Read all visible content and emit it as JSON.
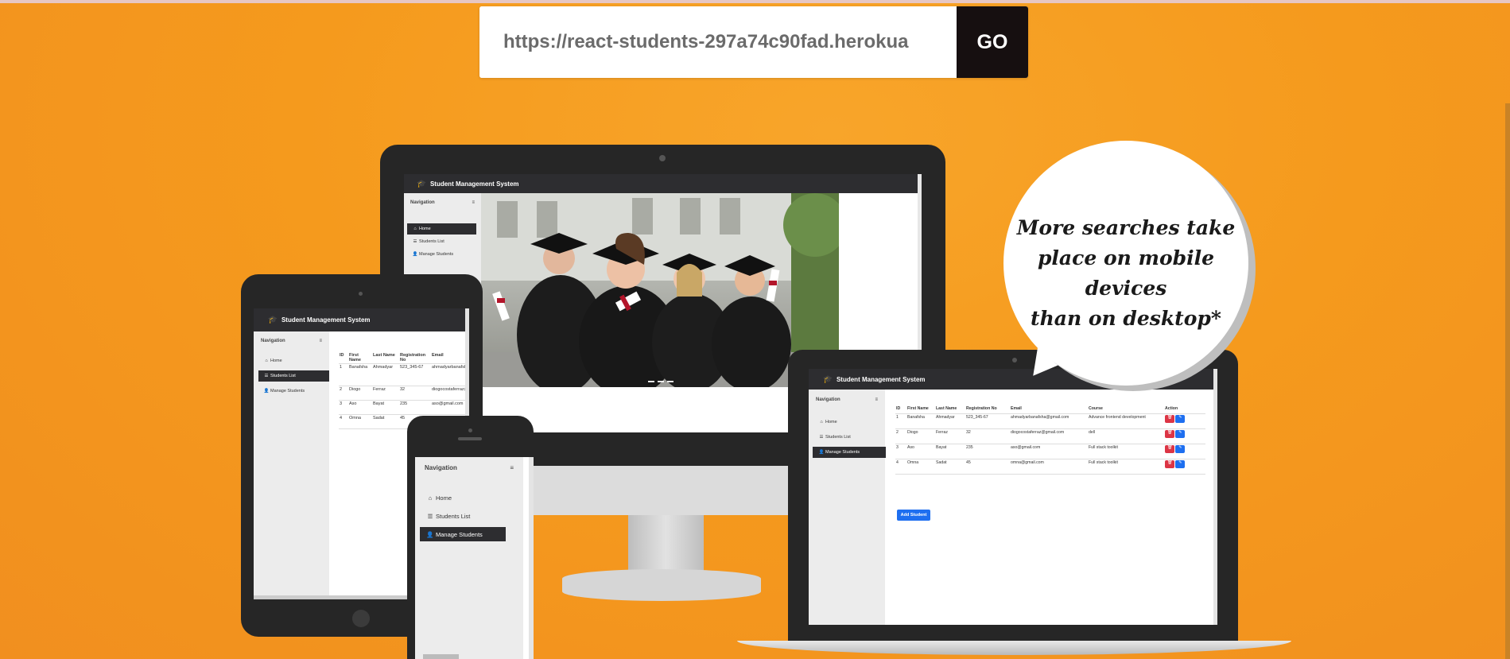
{
  "url_bar": {
    "value": "https://react-students-297a74c90fad.herokua",
    "go_label": "GO"
  },
  "app": {
    "title": "Student Management System"
  },
  "nav": {
    "heading": "Navigation",
    "items": [
      "Home",
      "Students List",
      "Manage Students"
    ]
  },
  "hero_image": {
    "description": "graduation"
  },
  "table": {
    "headers": [
      "ID",
      "First Name",
      "Last Name",
      "Registration No",
      "Email",
      "Course",
      "Action"
    ],
    "rows": [
      [
        "1",
        "Banafsha",
        "Ahmadyar",
        "523_345-67",
        "ahmadyarbanafsha@gmail.com",
        "Advance frontend development"
      ],
      [
        "2",
        "Diogo",
        "Ferraz",
        "32",
        "diogocostaferraz@gmail.com",
        "dell"
      ],
      [
        "3",
        "Aso",
        "Bayat",
        "235",
        "aso@gmail.com",
        "Full stack toolkit"
      ],
      [
        "4",
        "Omna",
        "Sadat",
        "45",
        "omna@gmail.com",
        "Full stack toolkit"
      ]
    ],
    "add_label": "Add Student"
  },
  "bubble": {
    "lines": [
      "More searches take",
      "place on mobile devices",
      "than on desktop*"
    ]
  },
  "colors": {
    "background": "#f59a1d",
    "dark": "#2d2d30",
    "delete": "#dc3545",
    "edit": "#1e6ff0"
  }
}
